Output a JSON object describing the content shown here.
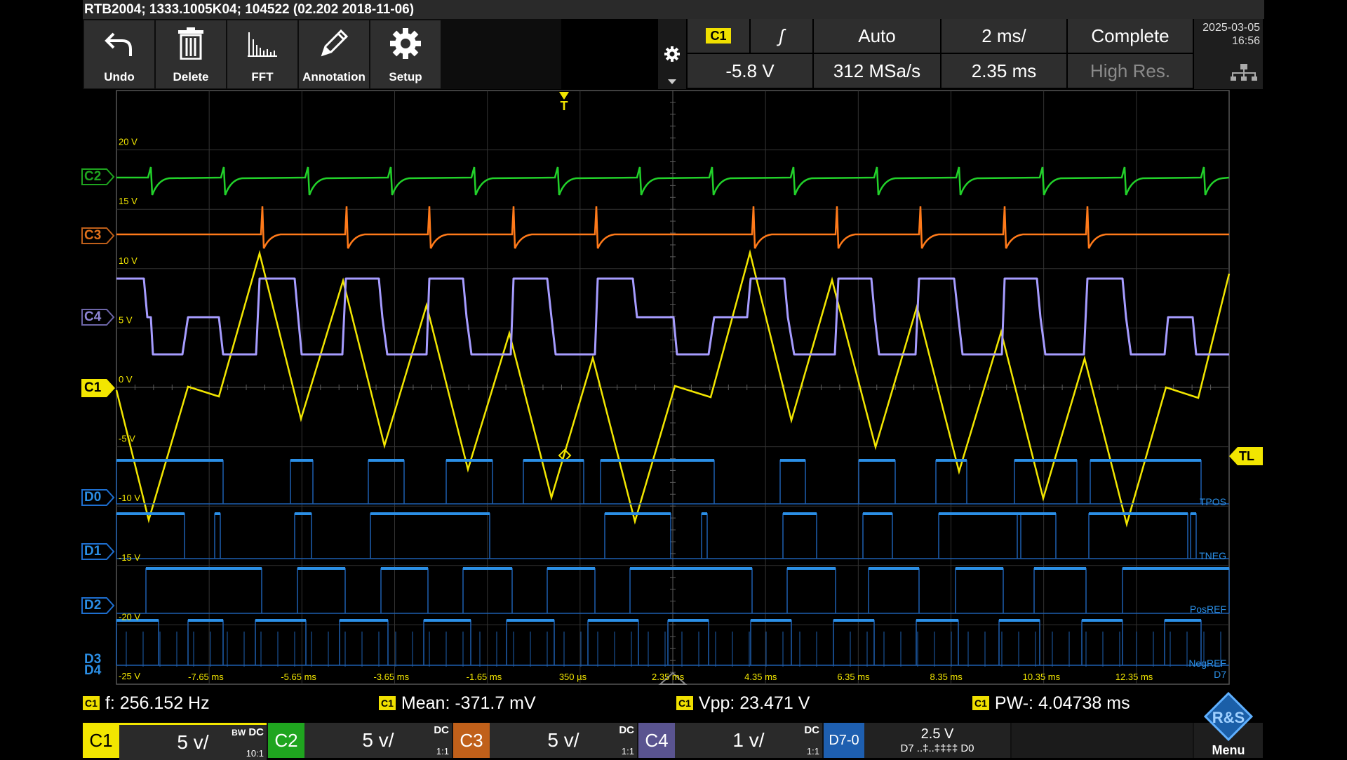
{
  "title": "RTB2004; 1333.1005K04; 104522 (02.202 2018-11-06)",
  "toolbar": {
    "buttons": [
      {
        "label": "Undo",
        "icon": "undo-icon"
      },
      {
        "label": "Delete",
        "icon": "trash-icon"
      },
      {
        "label": "FFT",
        "icon": "fft-icon"
      },
      {
        "label": "Annotation",
        "icon": "pencil-icon"
      },
      {
        "label": "Setup",
        "icon": "gear-icon"
      }
    ]
  },
  "status": {
    "trigger_source": "C1",
    "trigger_slope": "ʃ",
    "trigger_mode": "Auto",
    "timebase": "2 ms/",
    "acq_state": "Complete",
    "trigger_level": "-5.8 V",
    "sample_rate": "312 MSa/s",
    "horizontal_position": "2.35 ms",
    "acq_mode": "High Res.",
    "date": "2025-03-05",
    "time": "16:56"
  },
  "plot": {
    "channel_markers": {
      "c2": "C2",
      "c3": "C3",
      "c4": "C4",
      "c1": "C1",
      "d0": "D0",
      "d1": "D1",
      "d2": "D2",
      "d3": "D3",
      "d4": "D4"
    },
    "volt_labels": [
      "20 V",
      "15 V",
      "10 V",
      "5 V",
      "0 V",
      "-5 V",
      "-10 V",
      "-15 V",
      "-20 V",
      "-25 V"
    ],
    "time_labels": [
      "-7.65 ms",
      "-5.65 ms",
      "-3.65 ms",
      "-1.65 ms",
      "350 µs",
      "2.35 ms",
      "4.35 ms",
      "6.35 ms",
      "8.35 ms",
      "10.35 ms",
      "12.35 ms"
    ],
    "trigger_marker": "T",
    "trigger_level_marker": "TL",
    "digital_labels": [
      "TPOS",
      "TNEG",
      "PosREF",
      "NegREF",
      "D7"
    ]
  },
  "measurements": [
    {
      "source": "C1",
      "text": "f: 256.152 Hz"
    },
    {
      "source": "C1",
      "text": "Mean: -371.7 mV"
    },
    {
      "source": "C1",
      "text": "Vpp: 23.471 V"
    },
    {
      "source": "C1",
      "text": "PW-: 4.04738 ms"
    }
  ],
  "channels": [
    {
      "name": "C1",
      "scale": "5 v/",
      "coupling": "DC",
      "bw": "BW",
      "probe": "10:1",
      "color": "#f2e600"
    },
    {
      "name": "C2",
      "scale": "5 v/",
      "coupling": "DC",
      "probe": "1:1",
      "color": "#1fa51f"
    },
    {
      "name": "C3",
      "scale": "5 v/",
      "coupling": "DC",
      "probe": "1:1",
      "color": "#e0701a"
    },
    {
      "name": "C4",
      "scale": "1 v/",
      "coupling": "DC",
      "probe": "1:1",
      "color": "#8f86d6"
    }
  ],
  "logic": {
    "name": "D7-0",
    "threshold": "2.5 V",
    "bits_label": "D7 ..‡..‡‡‡‡ D0",
    "color": "#1e6fd0"
  },
  "menu_label": "Menu",
  "colors": {
    "c1": "#f2e600",
    "c2": "#22d12a",
    "c3": "#ff7a1a",
    "c4": "#a69cff",
    "digital": "#2b8fe6",
    "grid": "#3a3a3a"
  }
}
